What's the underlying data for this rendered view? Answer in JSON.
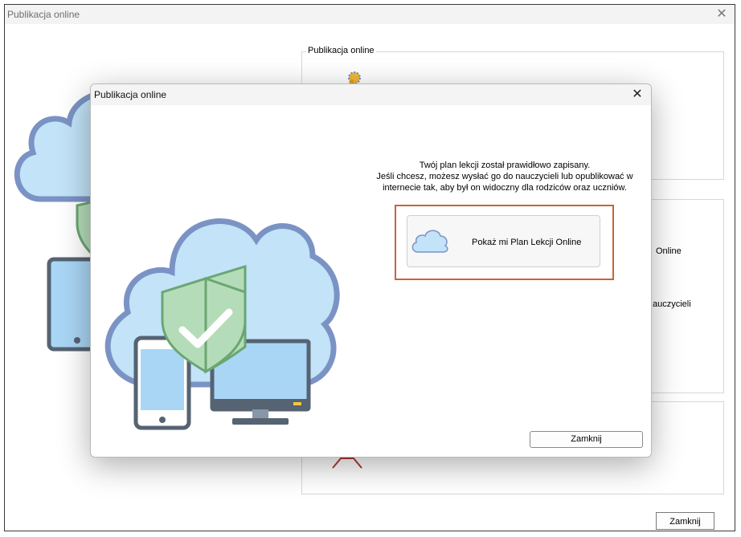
{
  "background_window": {
    "title": "Publikacja online",
    "close_glyph": "✕",
    "group_title": "Publikacja online",
    "option_label_1": "Online",
    "option_label_2": "auczycieli",
    "close_button": "Zamknij"
  },
  "dialog": {
    "title": "Publikacja online",
    "close_glyph": "✕",
    "message_lines": [
      "Twój plan lekcji został prawidłowo zapisany.",
      "Jeśli chcesz, możesz wysłać go do nauczycieli lub opublikować w",
      "internecie tak, aby był on widoczny dla rodziców oraz uczniów."
    ],
    "show_button": "Pokaż mi Plan Lekcji Online",
    "close_button": "Zamknij"
  },
  "colors": {
    "cloud_fill": "#c2e3f8",
    "cloud_stroke": "#7b93c4",
    "shield_fill": "#b5dcb8",
    "shield_stroke": "#6aa672",
    "device_frame": "#556372",
    "device_screen": "#a9d6f5",
    "highlight": "#c8643a"
  },
  "icons": [
    "cloud-icon",
    "shield-check-icon",
    "phone-icon",
    "monitor-icon",
    "gear-icon",
    "close-icon"
  ]
}
